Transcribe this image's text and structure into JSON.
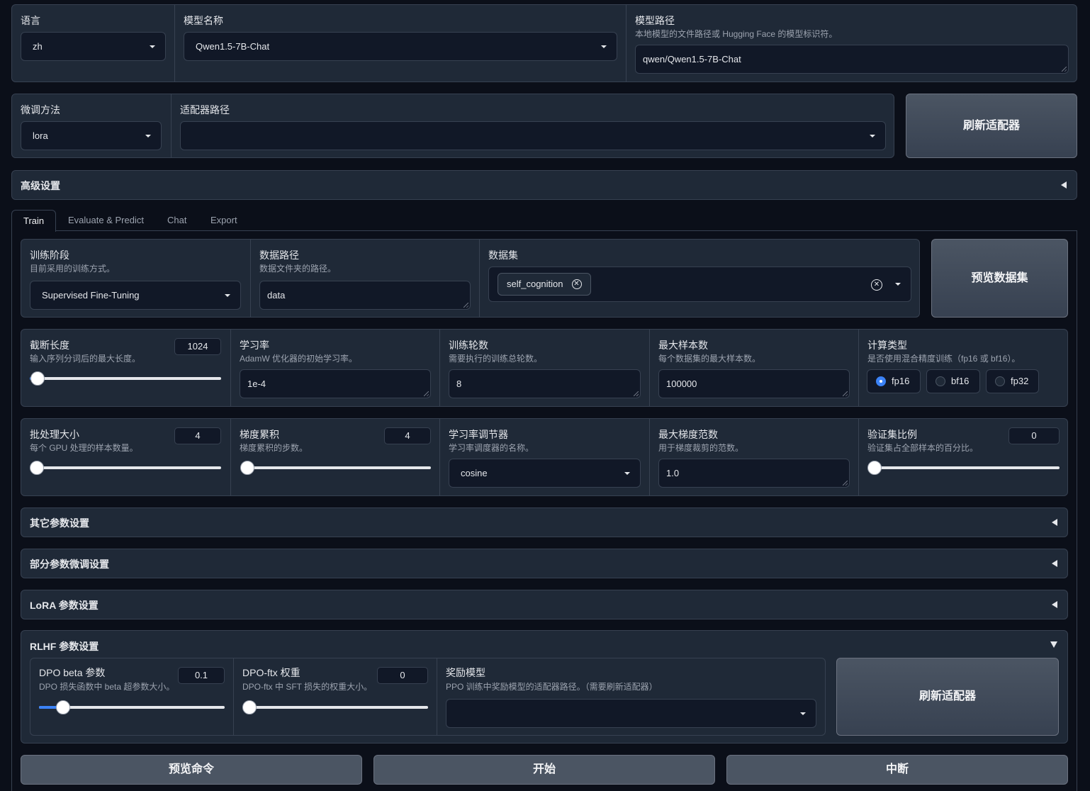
{
  "top": {
    "lang": {
      "label": "语言",
      "value": "zh"
    },
    "model_name": {
      "label": "模型名称",
      "value": "Qwen1.5-7B-Chat"
    },
    "model_path": {
      "label": "模型路径",
      "info": "本地模型的文件路径或 Hugging Face 的模型标识符。",
      "value": "qwen/Qwen1.5-7B-Chat"
    }
  },
  "row2": {
    "finetune": {
      "label": "微调方法",
      "value": "lora"
    },
    "adapter": {
      "label": "适配器路径",
      "value": ""
    },
    "refresh_label": "刷新适配器"
  },
  "advanced": {
    "label": "高级设置"
  },
  "tabs": [
    "Train",
    "Evaluate & Predict",
    "Chat",
    "Export"
  ],
  "train": {
    "stage": {
      "label": "训练阶段",
      "info": "目前采用的训练方式。",
      "value": "Supervised Fine-Tuning"
    },
    "data_path": {
      "label": "数据路径",
      "info": "数据文件夹的路径。",
      "value": "data"
    },
    "dataset": {
      "label": "数据集",
      "chip": "self_cognition"
    },
    "preview_dataset_label": "预览数据集",
    "cutoff": {
      "label": "截断长度",
      "info": "输入序列分词后的最大长度。",
      "value": "1024",
      "level": 0.04
    },
    "lr": {
      "label": "学习率",
      "info": "AdamW 优化器的初始学习率。",
      "value": "1e-4"
    },
    "epochs": {
      "label": "训练轮数",
      "info": "需要执行的训练总轮数。",
      "value": "8"
    },
    "max_samples": {
      "label": "最大样本数",
      "info": "每个数据集的最大样本数。",
      "value": "100000"
    },
    "compute": {
      "label": "计算类型",
      "info": "是否使用混合精度训练（fp16 或 bf16）。",
      "options": [
        "fp16",
        "bf16",
        "fp32"
      ],
      "selected": "fp16"
    },
    "batch": {
      "label": "批处理大小",
      "info": "每个 GPU 处理的样本数量。",
      "value": "4",
      "level": 0.0
    },
    "grad_acc": {
      "label": "梯度累积",
      "info": "梯度累积的步数。",
      "value": "4",
      "level": 0.0
    },
    "scheduler": {
      "label": "学习率调节器",
      "info": "学习率调度器的名称。",
      "value": "cosine"
    },
    "max_grad": {
      "label": "最大梯度范数",
      "info": "用于梯度裁剪的范数。",
      "value": "1.0"
    },
    "val": {
      "label": "验证集比例",
      "info": "验证集占全部样本的百分比。",
      "value": "0",
      "level": 0.0
    }
  },
  "accordions": {
    "other": "其它参数设置",
    "partial": "部分参数微调设置",
    "lora": "LoRA 参数设置",
    "rlhf": "RLHF 参数设置"
  },
  "rlhf": {
    "dpo_beta": {
      "label": "DPO beta 参数",
      "info": "DPO 损失函数中 beta 超参数大小。",
      "value": "0.1",
      "level": 0.13
    },
    "dpo_ftx": {
      "label": "DPO-ftx 权重",
      "info": "DPO-ftx 中 SFT 损失的权重大小。",
      "value": "0",
      "level": 0.0
    },
    "reward": {
      "label": "奖励模型",
      "info": "PPO 训练中奖励模型的适配器路径。（需要刷新适配器）",
      "value": ""
    },
    "refresh_label": "刷新适配器"
  },
  "actions": {
    "preview_cmd": "预览命令",
    "start": "开始",
    "stop": "中断"
  },
  "colors": {
    "bg": "#0b0f19",
    "panel": "#1f2937",
    "accent": "#3b82f6"
  }
}
